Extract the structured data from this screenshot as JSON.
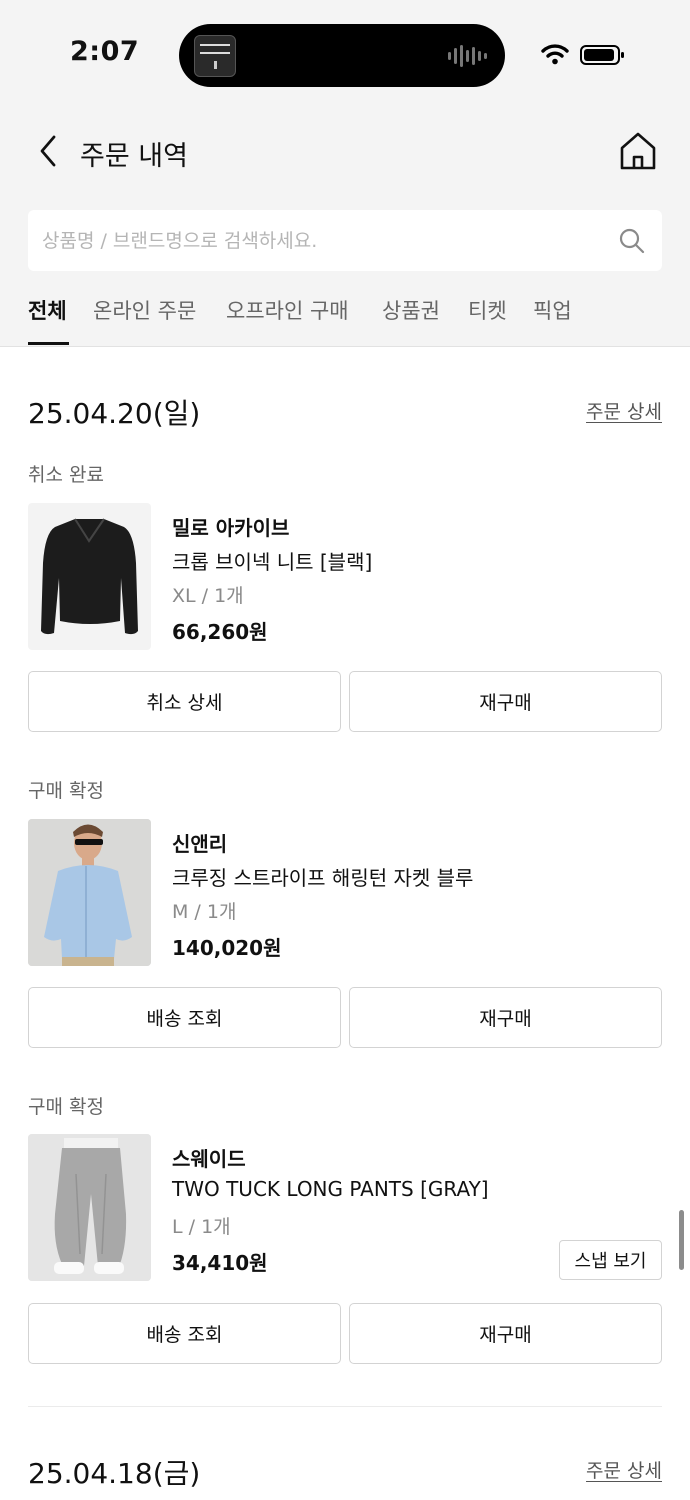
{
  "status_bar": {
    "time": "2:07"
  },
  "header": {
    "title": "주문 내역"
  },
  "search": {
    "placeholder": "상품명 / 브랜드명으로 검색하세요."
  },
  "tabs": [
    {
      "label": "전체",
      "active": true
    },
    {
      "label": "온라인 주문",
      "active": false
    },
    {
      "label": "오프라인 구매",
      "active": false
    },
    {
      "label": "상품권",
      "active": false
    },
    {
      "label": "티켓",
      "active": false
    },
    {
      "label": "픽업",
      "active": false
    }
  ],
  "orders": [
    {
      "date": "25.04.20(일)",
      "detail_link": "주문 상세",
      "items": [
        {
          "status": "취소 완료",
          "brand": "밀로 아카이브",
          "name": "크롭 브이넥 니트 [블랙]",
          "option": "XL / 1개",
          "price": "66,260원",
          "left_button": "취소 상세",
          "right_button": "재구매",
          "image": "black-knit-sweater"
        },
        {
          "status": "구매 확정",
          "brand": "신앤리",
          "name": "크루징 스트라이프 해링턴 자켓 블루",
          "option": "M / 1개",
          "price": "140,020원",
          "left_button": "배송 조회",
          "right_button": "재구매",
          "image": "model-blue-jacket"
        },
        {
          "status": "구매 확정",
          "brand": "스웨이드",
          "name": "TWO TUCK LONG PANTS [GRAY]",
          "option": "L / 1개",
          "price": "34,410원",
          "snap_button": "스냅 보기",
          "left_button": "배송 조회",
          "right_button": "재구매",
          "image": "gray-wide-pants"
        }
      ]
    },
    {
      "date": "25.04.18(금)",
      "detail_link": "주문 상세"
    }
  ],
  "colors": {
    "header_bg": "#f4f4f4",
    "text": "#111111",
    "muted": "#8a8a8a",
    "border": "#d3d3d3"
  }
}
